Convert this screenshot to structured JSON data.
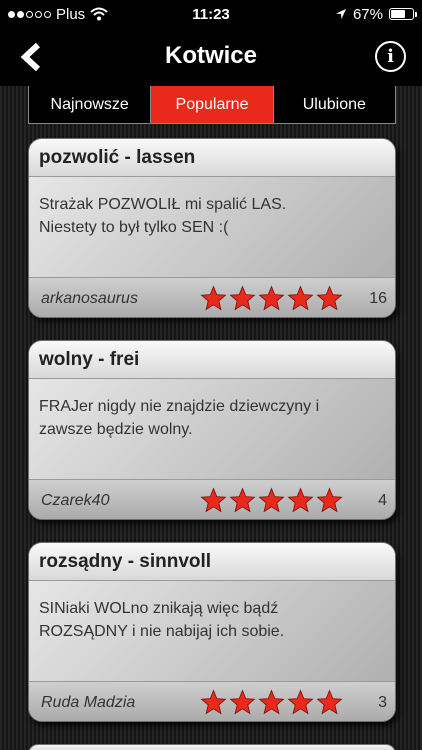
{
  "status_bar": {
    "carrier": "Plus",
    "time": "11:23",
    "battery": "67%",
    "battery_level": 0.67
  },
  "nav": {
    "title": "Kotwice"
  },
  "tabs": [
    {
      "label": "Najnowsze",
      "active": false
    },
    {
      "label": "Popularne",
      "active": true
    },
    {
      "label": "Ulubione",
      "active": false
    }
  ],
  "cards": [
    {
      "title": "pozwolić - lassen",
      "body": [
        "Strażak POZWOLIŁ mi spalić LAS.",
        "Niestety to był tylko SEN :("
      ],
      "author": "arkanosaurus",
      "rating": 5,
      "count": "16"
    },
    {
      "title": "wolny - frei",
      "body": [
        "FRAJer nigdy nie znajdzie dziewczyny i",
        "zawsze będzie wolny."
      ],
      "author": "Czarek40",
      "rating": 5,
      "count": "4"
    },
    {
      "title": "rozsądny - sinnvoll",
      "body": [
        "SINiaki WOLno znikają więc bądź",
        "ROZSĄDNY i nie nabijaj ich sobie."
      ],
      "author": "Ruda Madzia",
      "rating": 5,
      "count": "3"
    }
  ],
  "colors": {
    "accent": "#e8291c",
    "star": "#e8291c"
  }
}
